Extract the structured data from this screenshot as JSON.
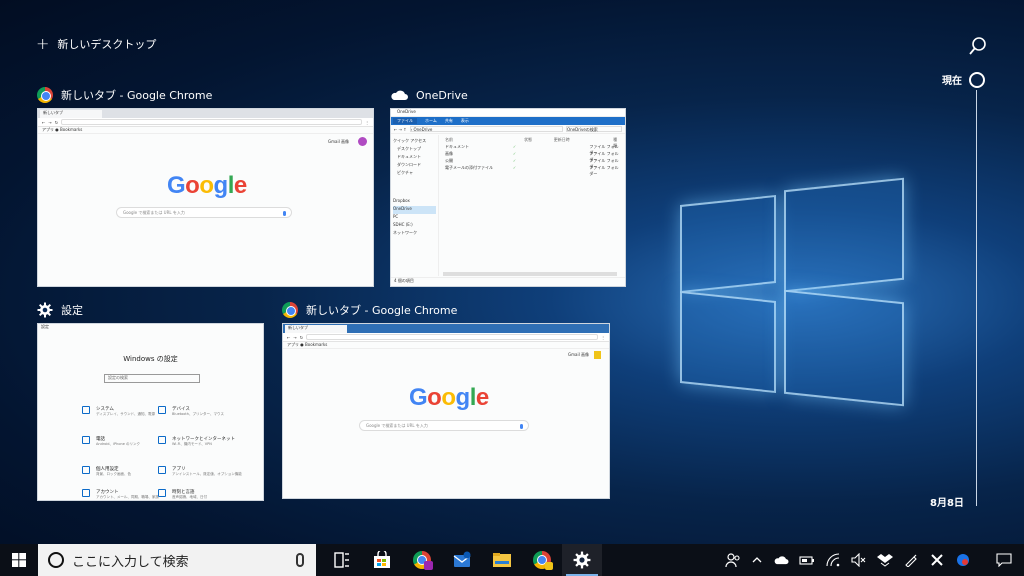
{
  "new_desktop": {
    "label": "新しいデスクトップ"
  },
  "timeline": {
    "now_label": "現在",
    "date_label": "8月8日"
  },
  "windows": [
    {
      "title": "新しいタブ - Google Chrome",
      "app": "chrome",
      "tab": "新しいタブ",
      "bookmark": "アプリ ● Bookmarks",
      "top_links": "Gmail  画像",
      "search_placeholder": "Google で検索または URL を入力"
    },
    {
      "title": "OneDrive",
      "app": "explorer",
      "window_title": "OneDrive",
      "ribbon": [
        "ファイル",
        "ホーム",
        "共有",
        "表示"
      ],
      "address": "› OneDrive",
      "search": "OneDriveの検索",
      "sidebar": [
        "クイック アクセス",
        "デスクトップ",
        "ドキュメント",
        "ダウンロード",
        "ピクチャ",
        "Dropbox",
        "OneDrive",
        "PC",
        "SDHC (E:)",
        "ネットワーク"
      ],
      "columns": [
        "名前",
        "状態",
        "更新日時",
        "種類"
      ],
      "files": [
        {
          "name": "ドキュメント",
          "status": "✓",
          "type": "ファイル フォルダー"
        },
        {
          "name": "画像",
          "status": "✓",
          "type": "ファイル フォルダー"
        },
        {
          "name": "公開",
          "status": "✓",
          "type": "ファイル フォルダー"
        },
        {
          "name": "電子メールの添付ファイル",
          "status": "✓",
          "type": "ファイル フォルダー"
        }
      ],
      "status_bar": "4 個の項目"
    },
    {
      "title": "設定",
      "app": "settings",
      "window_title": "設定",
      "heading": "Windows の設定",
      "search_placeholder": "設定の検索",
      "items": [
        {
          "name": "システム",
          "desc": "ディスプレイ、サウンド、通知、電源"
        },
        {
          "name": "デバイス",
          "desc": "Bluetooth、プリンター、マウス"
        },
        {
          "name": "電話",
          "desc": "Android、iPhone のリンク"
        },
        {
          "name": "ネットワークとインターネット",
          "desc": "Wi-Fi、機内モード、VPN"
        },
        {
          "name": "個人用設定",
          "desc": "背景、ロック画面、色"
        },
        {
          "name": "アプリ",
          "desc": "アンインストール、既定値、オプション機能"
        },
        {
          "name": "アカウント",
          "desc": "アカウント、メール、同期、職場、家族"
        },
        {
          "name": "時刻と言語",
          "desc": "音声認識、地域、日付"
        }
      ]
    },
    {
      "title": "新しいタブ - Google Chrome",
      "app": "chrome",
      "tab": "新しいタブ",
      "bookmark": "アプリ ● Bookmarks",
      "top_links": "Gmail  画像",
      "search_placeholder": "Google で検索または URL を入力"
    }
  ],
  "google_logo": [
    "G",
    "o",
    "o",
    "g",
    "l",
    "e"
  ],
  "taskbar": {
    "search_placeholder": "ここに入力して検索",
    "apps": [
      "task-view",
      "store",
      "chrome",
      "outlook",
      "file-explorer",
      "chrome",
      "settings"
    ],
    "active_app": "settings",
    "tray": [
      "people",
      "^",
      "onedrive",
      "battery",
      "wifi",
      "volume-muted",
      "dropbox",
      "pen",
      "x",
      "edge"
    ]
  }
}
